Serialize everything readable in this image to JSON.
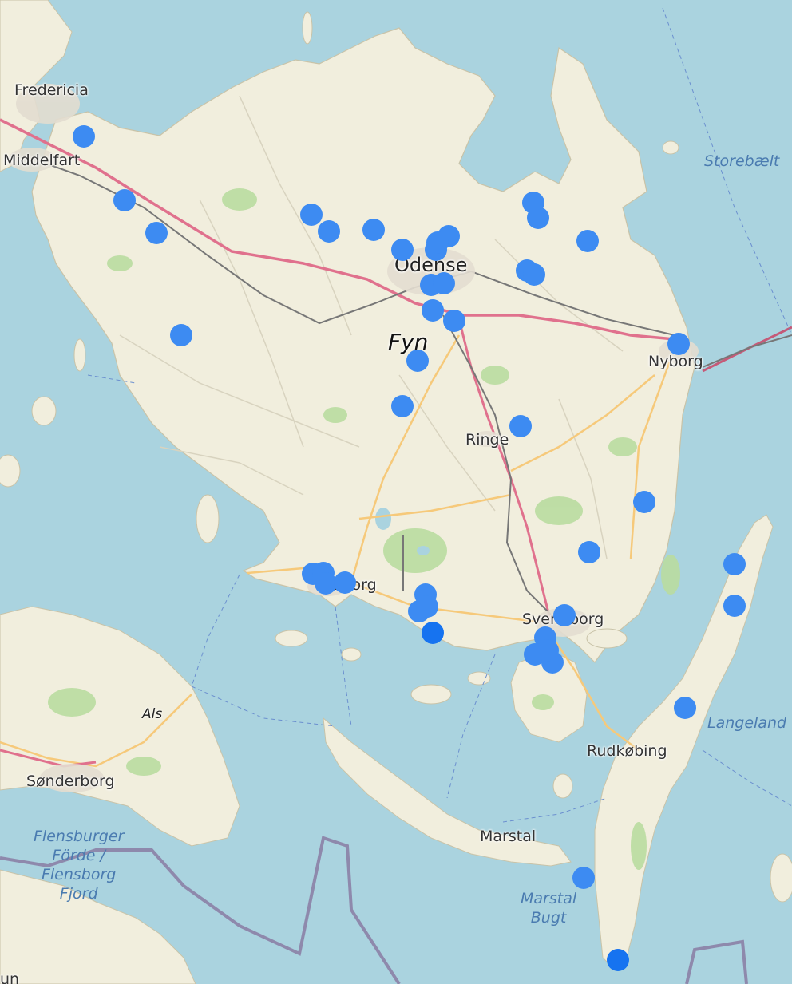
{
  "colors": {
    "water": "#aad3df",
    "land": "#f1eedd",
    "forest": "#a7d48c",
    "motorway": "#e0718d",
    "primary": "#f6c97a",
    "rail": "#777777",
    "border": "#8a7ba3",
    "marker": "#3d8bf2"
  },
  "labels": {
    "fredericia": "Fredericia",
    "middelfart": "Middelfart",
    "odense": "Odense",
    "fyn": "Fyn",
    "nyborg": "Nyborg",
    "ringe": "Ringe",
    "faaborg": "Faaborg",
    "svendborg": "Svendborg",
    "rudkobing": "Rudkøbing",
    "marstal": "Marstal",
    "als": "Als",
    "sonderborg": "Sønderborg",
    "langeland": "Langeland",
    "storebaelt": "Storebælt",
    "flensburger": "Flensburger\nFörde /\nFlensborg\nFjord",
    "marstal_bugt": "Marstal\nBugt",
    "bottom_cut": "un"
  },
  "markers": [
    {
      "name": "marker-1"
    },
    {
      "name": "marker-2"
    },
    {
      "name": "marker-3"
    },
    {
      "name": "marker-4"
    },
    {
      "name": "marker-5"
    },
    {
      "name": "marker-6"
    },
    {
      "name": "marker-7"
    },
    {
      "name": "marker-8"
    },
    {
      "name": "marker-9"
    },
    {
      "name": "marker-10"
    },
    {
      "name": "marker-11"
    },
    {
      "name": "marker-12"
    },
    {
      "name": "marker-13"
    },
    {
      "name": "marker-14"
    },
    {
      "name": "marker-15"
    },
    {
      "name": "marker-16"
    },
    {
      "name": "marker-17"
    },
    {
      "name": "marker-18"
    },
    {
      "name": "marker-19"
    },
    {
      "name": "marker-20"
    },
    {
      "name": "marker-21"
    },
    {
      "name": "marker-22"
    },
    {
      "name": "marker-23"
    },
    {
      "name": "marker-24"
    },
    {
      "name": "marker-25"
    },
    {
      "name": "marker-26"
    },
    {
      "name": "marker-27"
    },
    {
      "name": "marker-28"
    },
    {
      "name": "marker-29"
    },
    {
      "name": "marker-30"
    },
    {
      "name": "marker-31"
    },
    {
      "name": "marker-32"
    },
    {
      "name": "marker-33"
    },
    {
      "name": "marker-34"
    },
    {
      "name": "marker-35"
    },
    {
      "name": "marker-36"
    },
    {
      "name": "marker-37"
    },
    {
      "name": "marker-38"
    },
    {
      "name": "marker-39"
    },
    {
      "name": "marker-40"
    },
    {
      "name": "marker-41"
    },
    {
      "name": "marker-42"
    },
    {
      "name": "marker-43"
    },
    {
      "name": "marker-44"
    }
  ]
}
